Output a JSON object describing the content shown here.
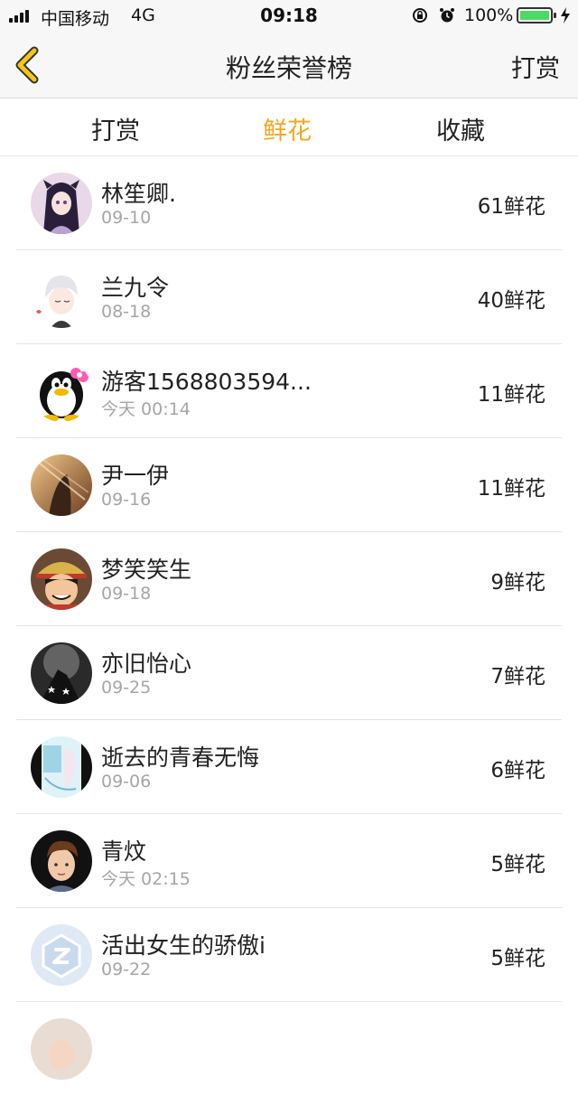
{
  "status_bar": {
    "carrier": "中国移动",
    "network": "4G",
    "time": "09:18",
    "battery": "100%"
  },
  "nav": {
    "title": "粉丝荣誉榜",
    "right_action": "打赏"
  },
  "tabs": [
    {
      "label": "打赏",
      "active": false
    },
    {
      "label": "鲜花",
      "active": true
    },
    {
      "label": "收藏",
      "active": false
    }
  ],
  "accent_color": "#f5a623",
  "fans": [
    {
      "name": "林笙卿.",
      "date": "09-10",
      "count": "61鲜花"
    },
    {
      "name": "兰九令",
      "date": "08-18",
      "count": "40鲜花"
    },
    {
      "name": "游客1568803594...",
      "date": "今天 00:14",
      "count": "11鲜花"
    },
    {
      "name": "尹一伊",
      "date": "09-16",
      "count": "11鲜花"
    },
    {
      "name": "梦笑笑生",
      "date": "09-18",
      "count": "9鲜花"
    },
    {
      "name": "亦旧怡心",
      "date": "09-25",
      "count": "7鲜花"
    },
    {
      "name": "逝去的青春无悔",
      "date": "09-06",
      "count": "6鲜花"
    },
    {
      "name": "青炆",
      "date": "今天 02:15",
      "count": "5鲜花"
    },
    {
      "name": "活出女生的骄傲i",
      "date": "09-22",
      "count": "5鲜花"
    }
  ]
}
